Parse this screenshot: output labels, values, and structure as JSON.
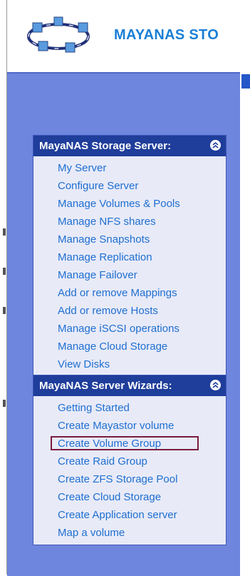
{
  "header": {
    "brand_text": "MAYANAS STO",
    "logo_icon": "network-ring-logo-icon"
  },
  "colors": {
    "brand": "#1a7fd6",
    "panel_bg": "#6f86de",
    "menu_header_bg": "#1f3d9a",
    "menu_bg": "#e8eaf8",
    "link": "#1e6fd0",
    "active_outline": "#7a1c3e"
  },
  "storage_menu": {
    "title": "MayaNAS Storage Server:",
    "collapse_icon": "chevron-up-circle-icon",
    "items": [
      {
        "label": "My Server"
      },
      {
        "label": "Configure Server"
      },
      {
        "label": "Manage Volumes & Pools"
      },
      {
        "label": "Manage NFS shares"
      },
      {
        "label": "Manage Snapshots"
      },
      {
        "label": "Manage Replication"
      },
      {
        "label": "Manage Failover"
      },
      {
        "label": "Add or remove Mappings"
      },
      {
        "label": "Add or remove Hosts"
      },
      {
        "label": "Manage iSCSI operations"
      },
      {
        "label": "Manage Cloud Storage"
      },
      {
        "label": "View Disks"
      }
    ]
  },
  "wizards_menu": {
    "title": "MayaNAS Server Wizards:",
    "collapse_icon": "chevron-up-circle-icon",
    "items": [
      {
        "label": "Getting Started"
      },
      {
        "label": "Create Mayastor volume"
      },
      {
        "label": "Create Volume Group"
      },
      {
        "label": "Create Raid Group"
      },
      {
        "label": "Create ZFS Storage Pool"
      },
      {
        "label": "Create Cloud Storage"
      },
      {
        "label": "Create Application server"
      },
      {
        "label": "Map a volume"
      }
    ],
    "active_item": "Create Volume Group"
  }
}
